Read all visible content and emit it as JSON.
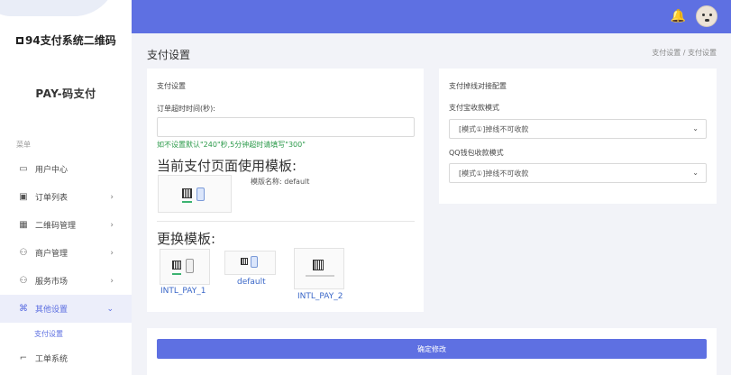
{
  "sidebar": {
    "brand": "94支付系统二维码",
    "subbrand": "PAY-码支付",
    "menu_caption": "菜单",
    "items": [
      {
        "label": "用户中心",
        "icon": "monitor-icon",
        "glyph": "▭",
        "arrow": ""
      },
      {
        "label": "订单列表",
        "icon": "list-icon",
        "glyph": "▣",
        "arrow": "›"
      },
      {
        "label": "二维码管理",
        "icon": "qr-icon",
        "glyph": "▦",
        "arrow": "›"
      },
      {
        "label": "商户管理",
        "icon": "users-icon",
        "glyph": "⚇",
        "arrow": "›"
      },
      {
        "label": "服务市场",
        "icon": "users-icon",
        "glyph": "⚇",
        "arrow": "›"
      },
      {
        "label": "其他设置",
        "icon": "command-icon",
        "glyph": "⌘",
        "arrow": "⌄"
      }
    ],
    "sub_item": "支付设置",
    "last_item": {
      "label": "工单系统",
      "icon": "ticket-icon",
      "glyph": "⌐"
    }
  },
  "topbar": {
    "accent": "#5e70e2",
    "bell_icon": "bell-icon",
    "bell_glyph": "🔔",
    "avatar_icon": "avatar-icon"
  },
  "header": {
    "title": "支付设置",
    "breadcrumb": "支付设置 / 支付设置"
  },
  "pay_card": {
    "title": "支付设置",
    "timeout_label": "订单超时时间(秒):",
    "timeout_value": "",
    "hint": "如不设置默认\"240\"秒,5分钟超时请填写\"300\"",
    "current_heading": "当前支付页面使用模板:",
    "template_name": "模版名称: default",
    "change_heading": "更换模板:",
    "templates": [
      "INTL_PAY_1",
      "default",
      "INTL_PAY_2"
    ]
  },
  "offline_card": {
    "title": "支付掉线对接配置",
    "wechat_label": "支付宝收款模式",
    "wechat_value": "[模式①]掉线不可收款",
    "qq_label": "QQ钱包收款模式",
    "qq_value": "[模式①]掉线不可收款"
  },
  "submit": {
    "label": "确定修改"
  }
}
